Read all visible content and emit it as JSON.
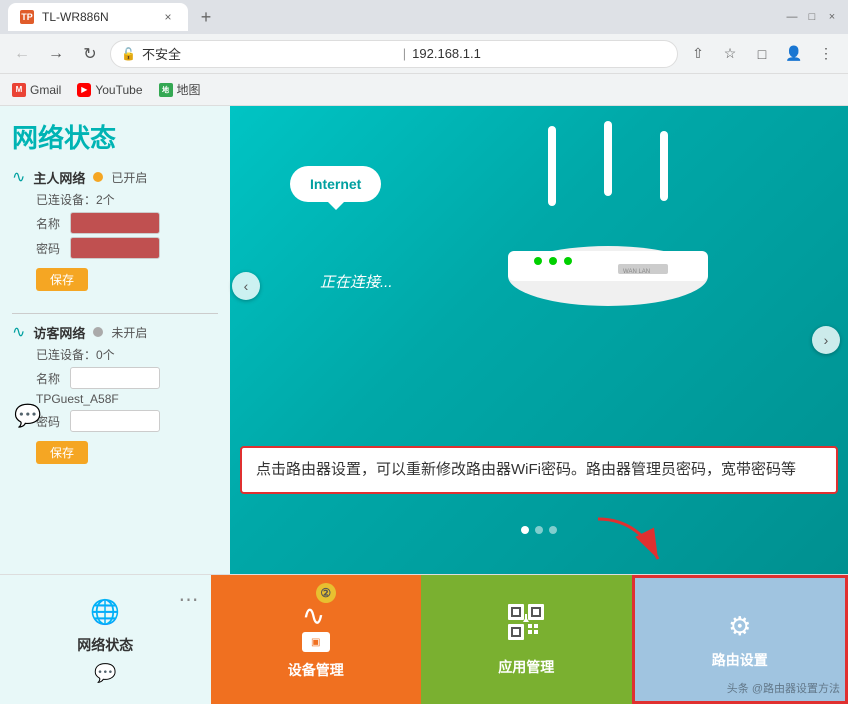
{
  "browser": {
    "tab_title": "TL-WR886N",
    "url": "192.168.1.1",
    "security_label": "不安全",
    "bookmarks": [
      {
        "label": "Gmail",
        "icon": "gmail"
      },
      {
        "label": "YouTube",
        "icon": "youtube"
      },
      {
        "label": "地图",
        "icon": "maps"
      }
    ],
    "window_controls": {
      "minimize": "—",
      "maximize": "□",
      "close": "×"
    }
  },
  "sidebar": {
    "title": "网络状态",
    "main_network": {
      "label": "主人网络",
      "status": "已开启",
      "devices": "已连设备：2个",
      "name_label": "名称",
      "password_label": "密码",
      "save_button": "保存"
    },
    "guest_network": {
      "label": "访客网络",
      "status": "未开启",
      "devices": "已连设备：0个",
      "name_label": "名称",
      "name_value": "TPGuest_A58F",
      "password_label": "密码",
      "save_button": "保存"
    }
  },
  "main_area": {
    "cloud_label": "Internet",
    "connecting_text": "正在连接...",
    "annotation_text": "点击路由器设置，可以重新修改路由器WiFi密码。路由器管理员密码，宽带密码等"
  },
  "bottom_nav": {
    "items": [
      {
        "id": "network-status",
        "label": "网络状态",
        "icon": "globe"
      },
      {
        "id": "device-mgmt",
        "label": "设备管理",
        "icon": "wifi"
      },
      {
        "id": "app-mgmt",
        "label": "应用管理",
        "icon": "qr"
      },
      {
        "id": "router-settings",
        "label": "路由设置",
        "icon": "gear"
      }
    ],
    "badge_number": "②"
  },
  "watermark": "头条 @路由器设置方法"
}
